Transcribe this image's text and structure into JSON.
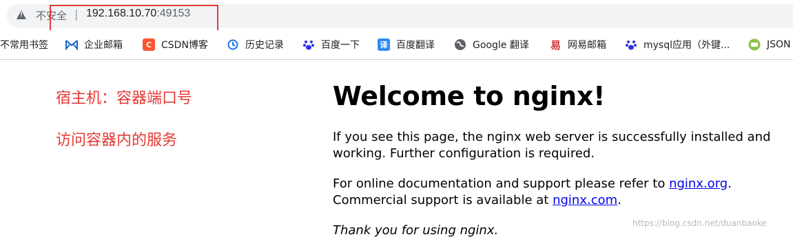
{
  "address_bar": {
    "security_label": "不安全",
    "separator": "|",
    "host": "192.168.10.70",
    "port": ":49153"
  },
  "bookmarks": [
    {
      "label": "不常用书签",
      "icon": "none"
    },
    {
      "label": "企业邮箱",
      "icon": "enterprise-mail-icon",
      "color": "#1565c0"
    },
    {
      "label": "CSDN博客",
      "icon": "csdn-icon",
      "color": "#fc5531",
      "glyph": "C"
    },
    {
      "label": "历史记录",
      "icon": "history-icon",
      "color": "#1a73e8"
    },
    {
      "label": "百度一下",
      "icon": "baidu-paw-icon",
      "color": "#2932e1"
    },
    {
      "label": "百度翻译",
      "icon": "baidu-translate-icon",
      "color": "#2d8cf0",
      "glyph": "译"
    },
    {
      "label": "Google 翻译",
      "icon": "globe-icon",
      "color": "#5f6368"
    },
    {
      "label": "网易邮箱",
      "icon": "netease-mail-icon",
      "color": "#d32f2f"
    },
    {
      "label": "mysql应用（外键...",
      "icon": "baidu-paw-icon",
      "color": "#2932e1"
    },
    {
      "label": "JSON",
      "icon": "json-icon",
      "color": "#8bc34a"
    }
  ],
  "annotations": {
    "line1": "宿主机：容器端口号",
    "line2": "访问容器内的服务",
    "color": "#e53935"
  },
  "nginx_page": {
    "title": "Welcome to nginx!",
    "p1": "If you see this page, the nginx web server is successfully installed and working. Further configuration is required.",
    "p2_before": "For online documentation and support please refer to ",
    "p2_link1": "nginx.org",
    "p2_mid": ".",
    "p2_line2_before": "Commercial support is available at ",
    "p2_link2": "nginx.com",
    "p2_end": ".",
    "p3": "Thank you for using nginx."
  },
  "watermark": "https://blog.csdn.net/duanbaoke"
}
